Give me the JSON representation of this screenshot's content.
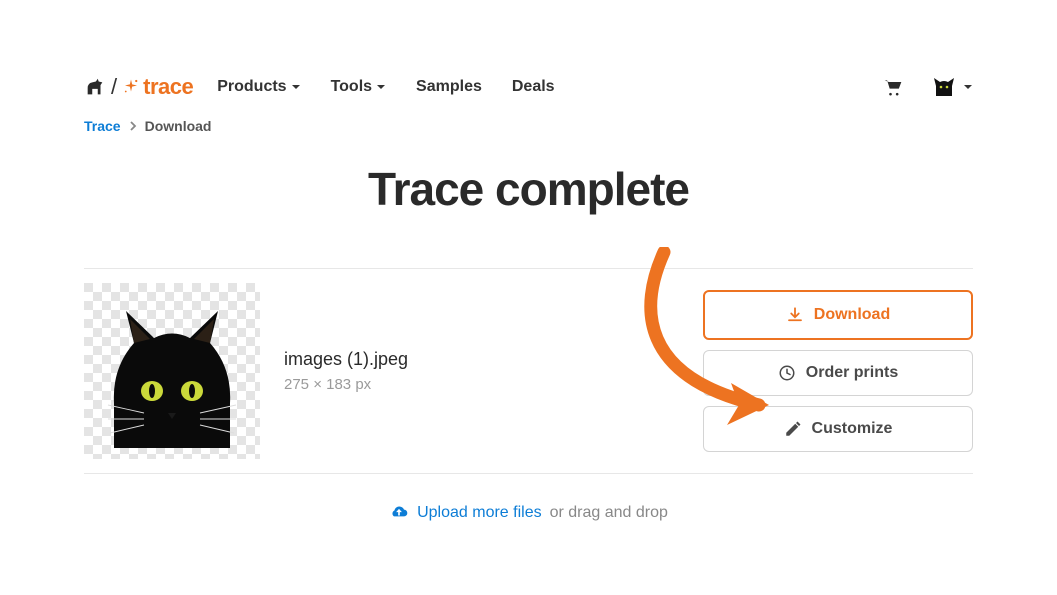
{
  "brand": {
    "word": "trace"
  },
  "nav": {
    "items": [
      {
        "label": "Products",
        "has_caret": true
      },
      {
        "label": "Tools",
        "has_caret": true
      },
      {
        "label": "Samples",
        "has_caret": false
      },
      {
        "label": "Deals",
        "has_caret": false
      }
    ]
  },
  "breadcrumb": {
    "root": "Trace",
    "current": "Download"
  },
  "title": "Trace complete",
  "file": {
    "name": "images (1).jpeg",
    "dimensions": "275 × 183 px"
  },
  "actions": {
    "download": "Download",
    "order_prints": "Order prints",
    "customize": "Customize"
  },
  "upload": {
    "link": "Upload more files",
    "rest": "or drag and drop"
  },
  "colors": {
    "accent": "#ed7321",
    "link": "#0d7dd6"
  }
}
